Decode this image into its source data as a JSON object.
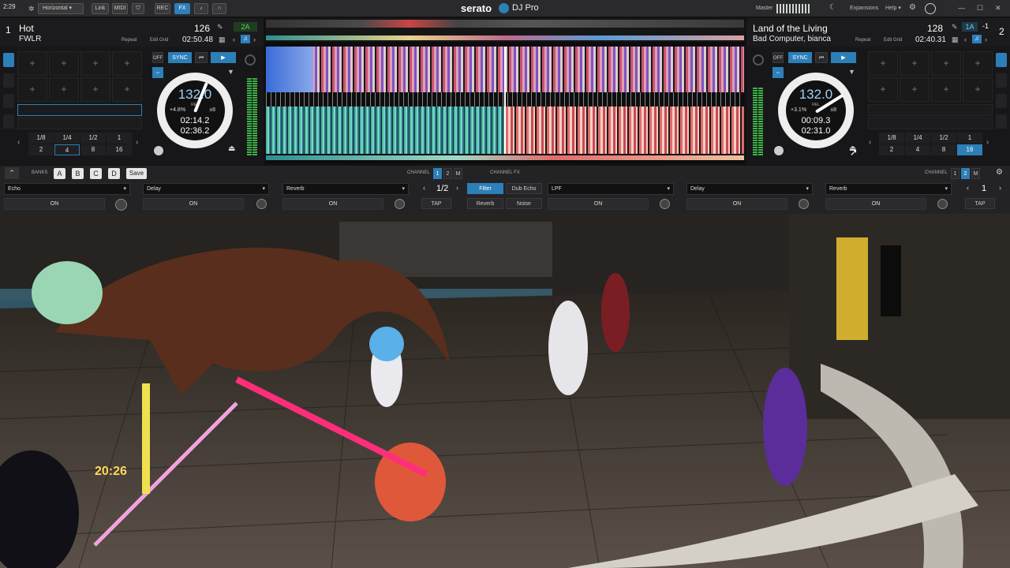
{
  "topbar": {
    "time": "2:29",
    "layout": "Horizontal",
    "link": "Link",
    "midi": "MIDI",
    "rec": "REC",
    "fx": "FX",
    "logo_main": "serato",
    "logo_sub": "DJ Pro",
    "master": "Master",
    "expansions": "Expansions",
    "help": "Help ▾"
  },
  "deck1": {
    "number": "1",
    "title": "Hot",
    "bpm": "126",
    "artist": "FWLR",
    "repeat": "Repeat",
    "edit_grid": "Edit Grid",
    "time": "02:50.48",
    "key": "2A",
    "bpm_platter": "132.0",
    "rel": "REL",
    "pitch": "+4.8%",
    "range": "±8",
    "elapsed": "02:14.2",
    "remain": "02:36.2",
    "off": "OFF",
    "sync": "SYNC",
    "loops": [
      "1/8",
      "1/4",
      "1/2",
      "1",
      "2",
      "4",
      "8",
      "16"
    ]
  },
  "deck2": {
    "number": "2",
    "title": "Land of the Living",
    "bpm": "128",
    "artist": "Bad Computer, bianca",
    "repeat": "Repeat",
    "edit_grid": "Edit Grid",
    "time": "02:40.31",
    "key": "1A",
    "key_adj": "-1",
    "bpm_platter": "132.0",
    "rel": "REL",
    "pitch": "+3.1%",
    "range": "±8",
    "elapsed": "00:09.3",
    "remain": "02:31.0",
    "off": "OFF",
    "sync": "SYNC",
    "loops": [
      "1/8",
      "1/4",
      "1/2",
      "1",
      "2",
      "4",
      "8",
      "16"
    ]
  },
  "fx": {
    "banks": "BANKS",
    "bank_a": "A",
    "bank_b": "B",
    "bank_c": "C",
    "bank_d": "D",
    "save": "Save",
    "channel_label": "CHANNEL",
    "ch1": "1",
    "ch2": "2",
    "chm": "M",
    "channel_fx": "CHANNEL FX",
    "unit1": [
      "Echo",
      "Delay",
      "Reverb"
    ],
    "unit2": [
      "LPF",
      "Delay",
      "Reverb"
    ],
    "on": "ON",
    "beats1": "1/2",
    "beats2": "1",
    "tap": "TAP",
    "filter": "Filter",
    "dub_echo": "Dub Echo",
    "reverb": "Reverb",
    "noise": "Noise"
  },
  "scene": {
    "sign": "20:26"
  },
  "colors": {
    "accent": "#2d7fb8",
    "meter": "#3fb14a"
  }
}
